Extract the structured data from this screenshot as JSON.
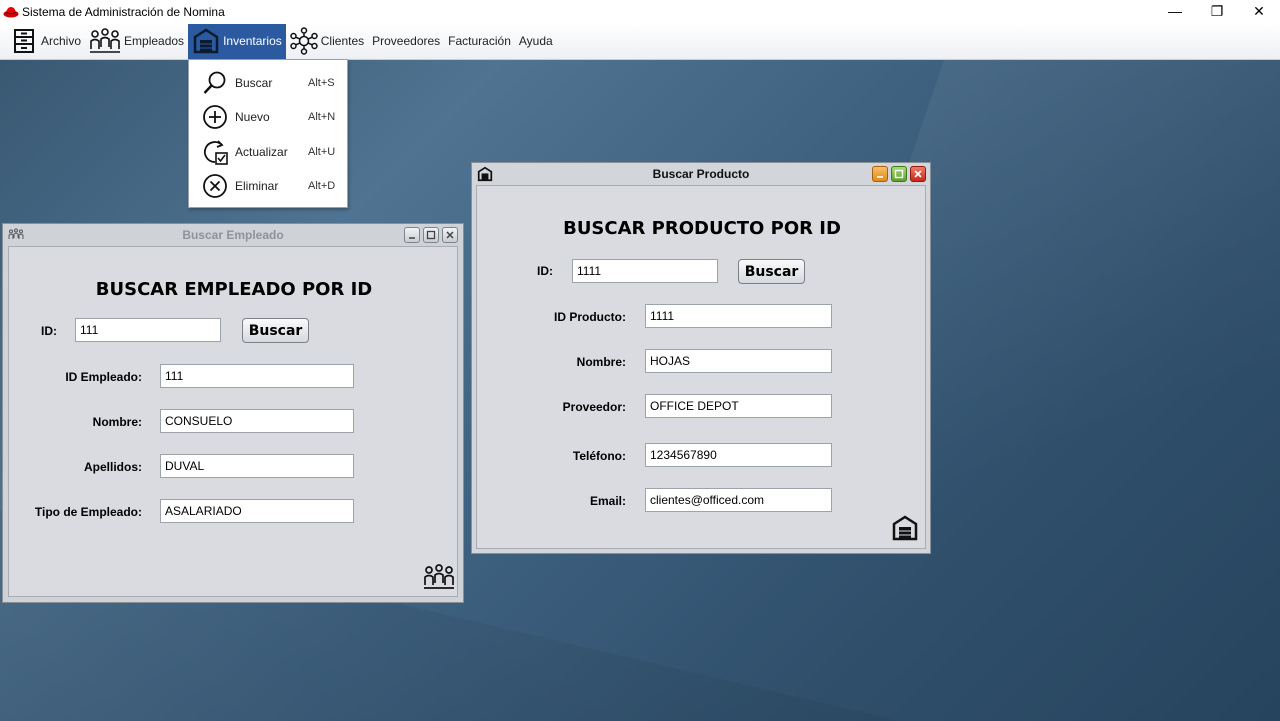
{
  "app": {
    "title": "Sistema de Administración de Nomina"
  },
  "window_controls": {
    "minimize": "—",
    "restore": "❐",
    "close": "✕"
  },
  "menu": {
    "archivo": "Archivo",
    "empleados": "Empleados",
    "inventarios": "Inventarios",
    "clientes": "Clientes",
    "proveedores": "Proveedores",
    "facturacion": "Facturación",
    "ayuda": "Ayuda"
  },
  "inventarios_menu": [
    {
      "label": "Buscar",
      "accel": "Alt+S",
      "icon": "search-icon"
    },
    {
      "label": "Nuevo",
      "accel": "Alt+N",
      "icon": "plus-circle-icon"
    },
    {
      "label": "Actualizar",
      "accel": "Alt+U",
      "icon": "refresh-check-icon"
    },
    {
      "label": "Eliminar",
      "accel": "Alt+D",
      "icon": "x-circle-icon"
    }
  ],
  "buscar_empleado": {
    "title": "Buscar Empleado",
    "heading": "BUSCAR EMPLEADO POR ID",
    "id_label": "ID:",
    "id_value": "111",
    "search_button": "Buscar",
    "fields": [
      {
        "label": "ID Empleado:",
        "value": "111"
      },
      {
        "label": "Nombre:",
        "value": "CONSUELO"
      },
      {
        "label": "Apellidos:",
        "value": "DUVAL"
      },
      {
        "label": "Tipo de Empleado:",
        "value": "ASALARIADO"
      }
    ]
  },
  "buscar_producto": {
    "title": "Buscar Producto",
    "heading": "BUSCAR PRODUCTO POR ID",
    "id_label": "ID:",
    "id_value": "1111",
    "search_button": "Buscar",
    "fields": [
      {
        "label": "ID Producto:",
        "value": "1111"
      },
      {
        "label": "Nombre:",
        "value": "HOJAS"
      },
      {
        "label": "Proveedor:",
        "value": "OFFICE DEPOT"
      },
      {
        "label": "Teléfono:",
        "value": "1234567890"
      },
      {
        "label": "Email:",
        "value": "clientes@officed.com"
      }
    ]
  },
  "colors": {
    "menu_active": "#2c5aa0",
    "minimize": "#e8a23a",
    "maximize": "#7bb84a",
    "close": "#d9412f"
  }
}
